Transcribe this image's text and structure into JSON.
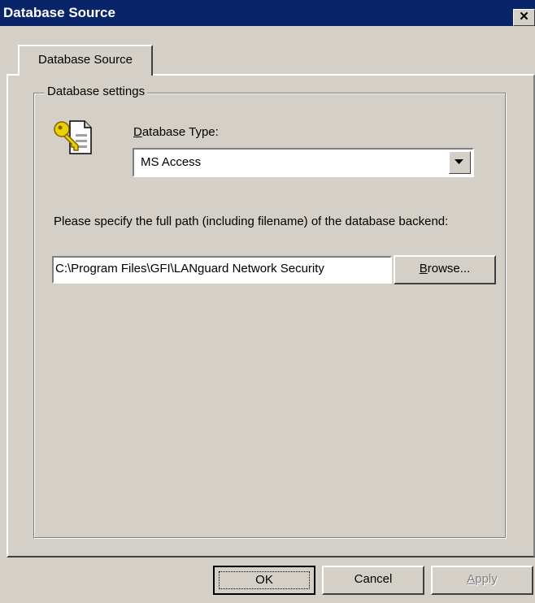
{
  "window": {
    "title": "Database Source",
    "close_glyph": "✕"
  },
  "tabs": [
    {
      "label": "Database Source",
      "selected": true
    }
  ],
  "group": {
    "legend": "Database settings"
  },
  "database_type": {
    "icon": "key-database-icon",
    "label": "Database Type:",
    "mnemonic": "D",
    "selected": "MS Access"
  },
  "path": {
    "description": "Please specify the full path (including filename) of the database backend:",
    "value": "C:\\Program Files\\GFI\\LANguard Network Security",
    "browse_label": "Browse...",
    "browse_mnemonic": "B"
  },
  "footer": {
    "ok_label": "OK",
    "cancel_label": "Cancel",
    "apply_label": "Apply",
    "apply_mnemonic": "A",
    "apply_enabled": false
  }
}
